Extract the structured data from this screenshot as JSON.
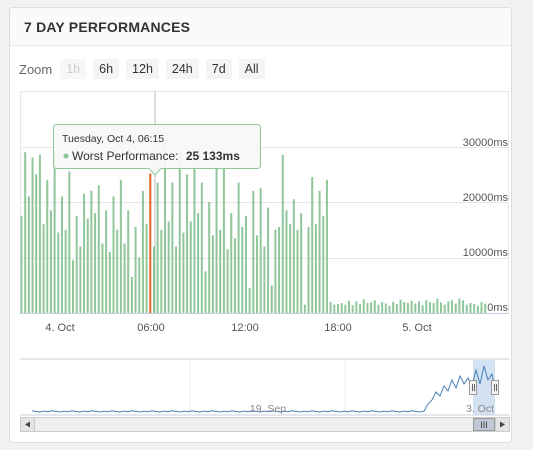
{
  "panel": {
    "title": "7 DAY PERFORMANCES"
  },
  "zoom": {
    "label": "Zoom",
    "buttons": [
      {
        "label": "1h",
        "disabled": true
      },
      {
        "label": "6h",
        "disabled": false
      },
      {
        "label": "12h",
        "disabled": false
      },
      {
        "label": "24h",
        "disabled": false
      },
      {
        "label": "7d",
        "disabled": false
      },
      {
        "label": "All",
        "disabled": false
      }
    ]
  },
  "tooltip": {
    "date": "Tuesday, Oct 4, 06:15",
    "series_label": "Worst Performance:",
    "value": "25 133ms"
  },
  "navigator": {
    "labels": [
      "19. Sep",
      "3. Oct"
    ],
    "scroll_handle": "III"
  },
  "colors": {
    "bar": "#90c79a",
    "highlight_bar": "#e0642a",
    "navigator_line": "#4a7eb5",
    "navigator_selection": "#c4d8ee"
  },
  "chart_data": {
    "type": "bar",
    "series": [
      {
        "name": "Worst Performance",
        "unit": "ms"
      }
    ],
    "x_tick_labels": [
      "4. Oct",
      "06:00",
      "12:00",
      "18:00",
      "5. Oct"
    ],
    "y_tick_labels": [
      "0ms",
      "10000ms",
      "20000ms",
      "30000ms"
    ],
    "ylim": [
      0,
      40000
    ],
    "grid": true,
    "values": [
      17500,
      29000,
      21000,
      28000,
      25000,
      28500,
      16000,
      24000,
      18500,
      28500,
      14500,
      21000,
      15000,
      25500,
      9500,
      17500,
      12000,
      21500,
      17000,
      22000,
      18000,
      23000,
      12500,
      18500,
      11000,
      21000,
      15000,
      24000,
      12500,
      18500,
      6500,
      15500,
      10000,
      22000,
      16000,
      25133,
      12000,
      23500,
      15000,
      30000,
      16500,
      23500,
      12000,
      29000,
      14500,
      25000,
      16500,
      27000,
      18000,
      23500,
      7500,
      20000,
      14000,
      26500,
      15000,
      26000,
      11500,
      18000,
      13500,
      23500,
      15500,
      17500,
      4500,
      22000,
      14000,
      22500,
      12000,
      19000,
      5000,
      15000,
      15500,
      28500,
      18500,
      16000,
      20500,
      15000,
      18000,
      1500,
      15500,
      24500,
      16000,
      22000,
      17500,
      24000,
      2000,
      1500,
      1600,
      1800,
      1500,
      2200,
      1400,
      2100,
      1600,
      2500,
      1800,
      1900,
      2300,
      1500,
      2000,
      1700,
      1300,
      2000,
      1600,
      2400,
      2000,
      1800,
      2200,
      1700,
      2100,
      1400,
      2300,
      2000,
      1800,
      2600,
      1900,
      1500,
      2100,
      2300,
      1700,
      2600,
      2300,
      1500,
      1800,
      1600,
      1300,
      2000,
      1700
    ],
    "highlight": {
      "index": 35,
      "x": "Tuesday, Oct 4, 06:15",
      "y": 25133
    }
  }
}
